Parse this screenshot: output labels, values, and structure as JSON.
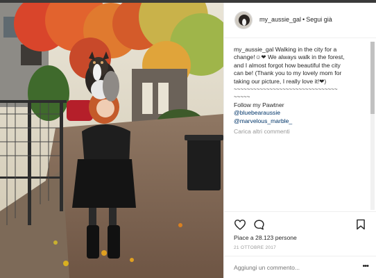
{
  "post": {
    "username": "my_aussie_gal",
    "separator": "•",
    "follow_label": "Segui già",
    "caption_user": "my_aussie_gal",
    "caption_lines": [
      "Walking in the city for a",
      "change!☺❤ We always walk in the forest,",
      "and I almost forgot how beautiful the city",
      "can be! (Thank you to my lovely mom for",
      "taking our picture, I really love it!❤)",
      "~~~~~~~~~~~~~~~~~~~~~~~~~~~~~~~~",
      "~~~~~",
      "Follow my Pawtner"
    ],
    "mention_1": "@bluebearaussie",
    "mention_2": "@marvelous_marble_",
    "load_more": "Carica altri commenti",
    "likes": "Piace a 28.123 persone",
    "date": "21 OTTOBRE 2017",
    "add_comment_placeholder": "Aggiungi un commento...",
    "more_options": "•••"
  },
  "icons": {
    "like": "heart-outline-icon",
    "comment": "comment-bubble-icon",
    "save": "bookmark-icon",
    "more": "more-options-icon"
  },
  "colors": {
    "text": "#262626",
    "muted": "#999999",
    "link": "#003569",
    "divider": "#efefef"
  }
}
